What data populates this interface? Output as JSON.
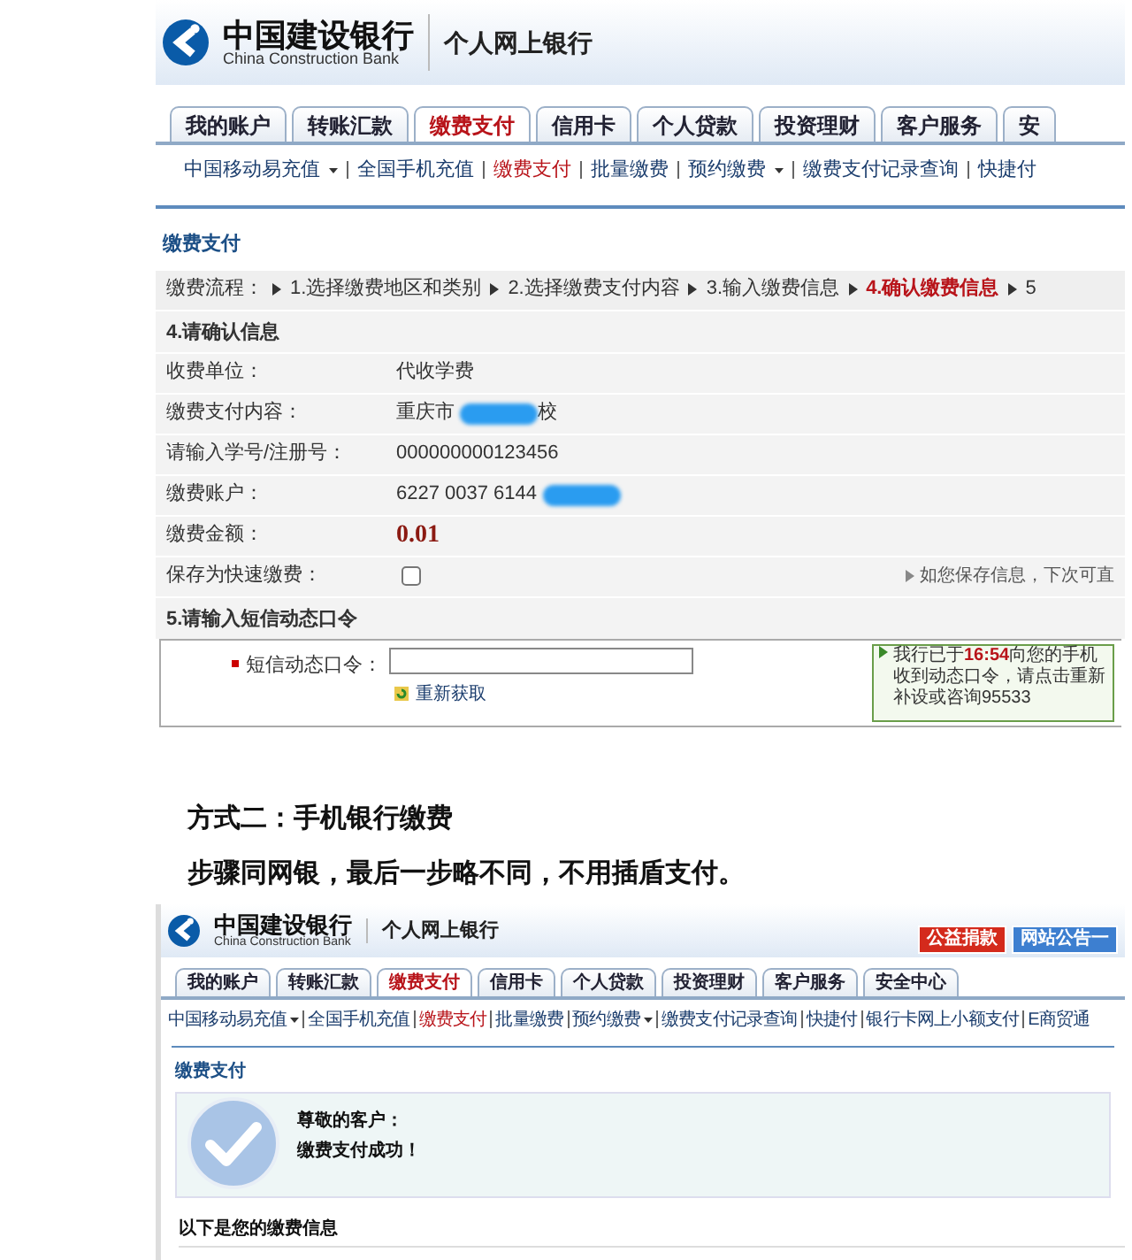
{
  "screenshot_1": {
    "header": {
      "bank_name": "中国建设银行",
      "bank_name_en": "China Construction Bank",
      "product": "个人网上银行"
    },
    "tabs": [
      {
        "label": "我的账户",
        "selected": false
      },
      {
        "label": "转账汇款",
        "selected": false
      },
      {
        "label": "缴费支付",
        "selected": true
      },
      {
        "label": "信用卡",
        "selected": false
      },
      {
        "label": "个人贷款",
        "selected": false
      },
      {
        "label": "投资理财",
        "selected": false
      },
      {
        "label": "客户服务",
        "selected": false
      },
      {
        "label": "安",
        "selected": false
      }
    ],
    "submenu": [
      {
        "label": "中国移动易充值",
        "dropdown": true,
        "selected": false
      },
      {
        "label": "全国手机充值",
        "dropdown": false,
        "selected": false
      },
      {
        "label": "缴费支付",
        "dropdown": false,
        "selected": true
      },
      {
        "label": "批量缴费",
        "dropdown": false,
        "selected": false
      },
      {
        "label": "预约缴费",
        "dropdown": true,
        "selected": false
      },
      {
        "label": "缴费支付记录查询",
        "dropdown": false,
        "selected": false
      },
      {
        "label": "快捷付",
        "dropdown": false,
        "selected": false
      }
    ],
    "page_title": "缴费支付",
    "flow": {
      "label": "缴费流程：",
      "steps": [
        {
          "label": "1.选择缴费地区和类别",
          "selected": false
        },
        {
          "label": "2.选择缴费支付内容",
          "selected": false
        },
        {
          "label": "3.输入缴费信息",
          "selected": false
        },
        {
          "label": "4.确认缴费信息",
          "selected": true
        },
        {
          "label": "5",
          "selected": false
        }
      ]
    },
    "section_1": "4.请确认信息",
    "rows": [
      {
        "kind": "text",
        "label": "收费单位：",
        "value": "代收学费"
      },
      {
        "kind": "redacted",
        "label": "缴费支付内容：",
        "value": "重庆市",
        "value_after": "校"
      },
      {
        "kind": "text",
        "label": "请输入学号/注册号：",
        "value": "000000000123456"
      },
      {
        "kind": "redacted",
        "label": "缴费账户：",
        "value": "6227 0037 6144"
      },
      {
        "kind": "amount",
        "label": "缴费金额：",
        "value": "0.01"
      },
      {
        "kind": "checkbox",
        "label": "保存为快速缴费：",
        "checked": false,
        "hint": "如您保存信息，下次可直"
      }
    ],
    "section_2": "5.请输入短信动态口令",
    "otp": {
      "label": "短信动态口令：",
      "required": true,
      "refresh": "重新获取",
      "notice": [
        "我行已于**16:54**向您的手机",
        "收到动态口令，请点击重新",
        "补设或咨询95533"
      ]
    }
  },
  "caption": {
    "heading": "方式二：手机银行缴费",
    "text": "步骤同网银，最后一步略不同，不用插盾支付。"
  },
  "screenshot_2": {
    "header": {
      "bank_name": "中国建设银行",
      "bank_name_en": "China Construction Bank",
      "product": "个人网上银行"
    },
    "header_buttons": [
      {
        "label": "公益捐款",
        "color": "#d42a1c"
      },
      {
        "label": "网站公告一",
        "color": "#3d7fd0"
      }
    ],
    "tabs": [
      {
        "label": "我的账户",
        "selected": false
      },
      {
        "label": "转账汇款",
        "selected": false
      },
      {
        "label": "缴费支付",
        "selected": true
      },
      {
        "label": "信用卡",
        "selected": false
      },
      {
        "label": "个人贷款",
        "selected": false
      },
      {
        "label": "投资理财",
        "selected": false
      },
      {
        "label": "客户服务",
        "selected": false
      },
      {
        "label": "安全中心",
        "selected": false
      }
    ],
    "submenu": [
      {
        "label": "中国移动易充值",
        "dropdown": true,
        "selected": false
      },
      {
        "label": "全国手机充值",
        "dropdown": false,
        "selected": false
      },
      {
        "label": "缴费支付",
        "dropdown": false,
        "selected": true
      },
      {
        "label": "批量缴费",
        "dropdown": false,
        "selected": false
      },
      {
        "label": "预约缴费",
        "dropdown": true,
        "selected": false
      },
      {
        "label": "缴费支付记录查询",
        "dropdown": false,
        "selected": false
      },
      {
        "label": "快捷付",
        "dropdown": false,
        "selected": false
      },
      {
        "label": "银行卡网上小额支付",
        "dropdown": false,
        "selected": false
      },
      {
        "label": "E商贸通",
        "dropdown": false,
        "selected": false
      }
    ],
    "page_title": "缴费支付",
    "success": {
      "greeting": "尊敬的客户：",
      "message": "缴费支付成功！"
    },
    "info_heading": "以下是您的缴费信息"
  }
}
